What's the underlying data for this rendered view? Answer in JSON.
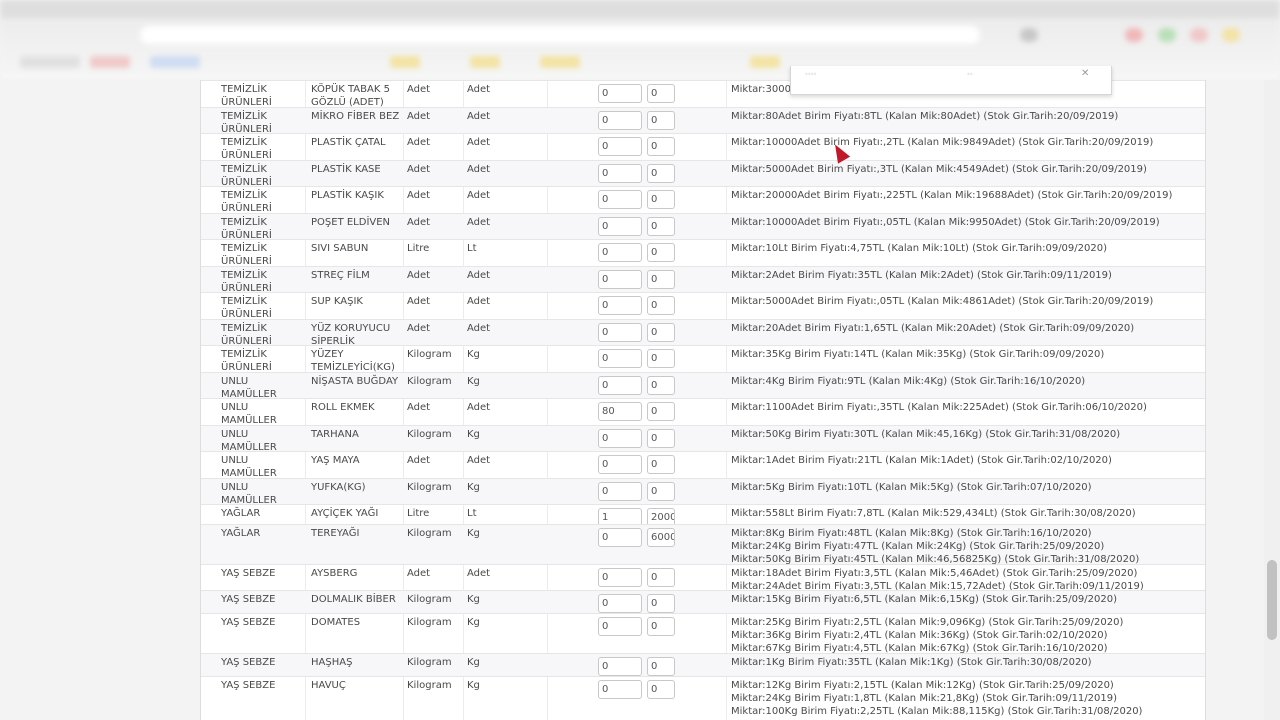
{
  "rows": [
    {
      "cat": "TEMİZLİK ÜRÜNLERİ",
      "name": "KÖPÜK TABAK 5 GÖZLÜ (ADET)",
      "unit1": "Adet",
      "unit2": "Adet",
      "v1": "0",
      "v2": "0",
      "info": [
        "Miktar:3000"
      ]
    },
    {
      "cat": "TEMİZLİK ÜRÜNLERİ",
      "name": "MİKRO FİBER BEZ",
      "unit1": "Adet",
      "unit2": "Adet",
      "v1": "0",
      "v2": "0",
      "info": [
        "Miktar:80Adet Birim Fiyatı:8TL (Kalan Mik:80Adet) (Stok Gir.Tarih:20/09/2019)"
      ]
    },
    {
      "cat": "TEMİZLİK ÜRÜNLERİ",
      "name": "PLASTİK ÇATAL",
      "unit1": "Adet",
      "unit2": "Adet",
      "v1": "0",
      "v2": "0",
      "info": [
        "Miktar:10000Adet Birim Fiyatı:,2TL (Kalan Mik:9849Adet) (Stok Gir.Tarih:20/09/2019)"
      ]
    },
    {
      "cat": "TEMİZLİK ÜRÜNLERİ",
      "name": "PLASTİK KASE",
      "unit1": "Adet",
      "unit2": "Adet",
      "v1": "0",
      "v2": "0",
      "info": [
        "Miktar:5000Adet Birim Fiyatı:,3TL (Kalan Mik:4549Adet) (Stok Gir.Tarih:20/09/2019)"
      ]
    },
    {
      "cat": "TEMİZLİK ÜRÜNLERİ",
      "name": "PLASTİK KAŞIK",
      "unit1": "Adet",
      "unit2": "Adet",
      "v1": "0",
      "v2": "0",
      "info": [
        "Miktar:20000Adet Birim Fiyatı:,225TL (Kalan Mik:19688Adet) (Stok Gir.Tarih:20/09/2019)"
      ]
    },
    {
      "cat": "TEMİZLİK ÜRÜNLERİ",
      "name": "POŞET ELDİVEN",
      "unit1": "Adet",
      "unit2": "Adet",
      "v1": "0",
      "v2": "0",
      "info": [
        "Miktar:10000Adet Birim Fiyatı:,05TL (Kalan Mik:9950Adet) (Stok Gir.Tarih:20/09/2019)"
      ]
    },
    {
      "cat": "TEMİZLİK ÜRÜNLERİ",
      "name": "SIVI SABUN",
      "unit1": "Litre",
      "unit2": "Lt",
      "v1": "0",
      "v2": "0",
      "info": [
        "Miktar:10Lt Birim Fiyatı:4,75TL (Kalan Mik:10Lt) (Stok Gir.Tarih:09/09/2020)"
      ]
    },
    {
      "cat": "TEMİZLİK ÜRÜNLERİ",
      "name": "STREÇ FİLM",
      "unit1": "Adet",
      "unit2": "Adet",
      "v1": "0",
      "v2": "0",
      "info": [
        "Miktar:2Adet Birim Fiyatı:35TL (Kalan Mik:2Adet) (Stok Gir.Tarih:09/11/2019)"
      ]
    },
    {
      "cat": "TEMİZLİK ÜRÜNLERİ",
      "name": "SUP KAŞIK",
      "unit1": "Adet",
      "unit2": "Adet",
      "v1": "0",
      "v2": "0",
      "info": [
        "Miktar:5000Adet Birim Fiyatı:,05TL (Kalan Mik:4861Adet) (Stok Gir.Tarih:20/09/2019)"
      ]
    },
    {
      "cat": "TEMİZLİK ÜRÜNLERİ",
      "name": "YÜZ KORUYUCU SİPERLİK",
      "unit1": "Adet",
      "unit2": "Adet",
      "v1": "0",
      "v2": "0",
      "info": [
        "Miktar:20Adet Birim Fiyatı:1,65TL (Kalan Mik:20Adet) (Stok Gir.Tarih:09/09/2020)"
      ]
    },
    {
      "cat": "TEMİZLİK ÜRÜNLERİ",
      "name": "YÜZEY TEMİZLEYİCİ(KG)",
      "unit1": "Kilogram",
      "unit2": "Kg",
      "v1": "0",
      "v2": "0",
      "info": [
        "Miktar:35Kg Birim Fiyatı:14TL (Kalan Mik:35Kg) (Stok Gir.Tarih:09/09/2020)"
      ]
    },
    {
      "cat": "UNLU MAMÜLLER",
      "name": "NİŞASTA BUĞDAY",
      "unit1": "Kilogram",
      "unit2": "Kg",
      "v1": "0",
      "v2": "0",
      "info": [
        "Miktar:4Kg Birim Fiyatı:9TL (Kalan Mik:4Kg) (Stok Gir.Tarih:16/10/2020)"
      ]
    },
    {
      "cat": "UNLU MAMÜLLER",
      "name": "ROLL EKMEK",
      "unit1": "Adet",
      "unit2": "Adet",
      "v1": "80",
      "v2": "0",
      "info": [
        "Miktar:1100Adet Birim Fiyatı:,35TL (Kalan Mik:225Adet) (Stok Gir.Tarih:06/10/2020)"
      ]
    },
    {
      "cat": "UNLU MAMÜLLER",
      "name": "TARHANA",
      "unit1": "Kilogram",
      "unit2": "Kg",
      "v1": "0",
      "v2": "0",
      "info": [
        "Miktar:50Kg Birim Fiyatı:30TL (Kalan Mik:45,16Kg) (Stok Gir.Tarih:31/08/2020)"
      ]
    },
    {
      "cat": "UNLU MAMÜLLER",
      "name": "YAŞ MAYA",
      "unit1": "Adet",
      "unit2": "Adet",
      "v1": "0",
      "v2": "0",
      "info": [
        "Miktar:1Adet Birim Fiyatı:21TL (Kalan Mik:1Adet) (Stok Gir.Tarih:02/10/2020)"
      ]
    },
    {
      "cat": "UNLU MAMÜLLER",
      "name": "YUFKA(KG)",
      "unit1": "Kilogram",
      "unit2": "Kg",
      "v1": "0",
      "v2": "0",
      "info": [
        "Miktar:5Kg Birim Fiyatı:10TL (Kalan Mik:5Kg) (Stok Gir.Tarih:07/10/2020)"
      ]
    },
    {
      "cat": "YAĞLAR",
      "name": "AYÇİÇEK YAĞI",
      "unit1": "Litre",
      "unit2": "Lt",
      "v1": "1",
      "v2": "2000",
      "info": [
        "Miktar:558Lt Birim Fiyatı:7,8TL (Kalan Mik:529,434Lt) (Stok Gir.Tarih:30/08/2020)"
      ]
    },
    {
      "cat": "YAĞLAR",
      "name": "TEREYAĞI",
      "unit1": "Kilogram",
      "unit2": "Kg",
      "v1": "0",
      "v2": "6000",
      "info": [
        "Miktar:8Kg Birim Fiyatı:48TL (Kalan Mik:8Kg) (Stok Gir.Tarih:16/10/2020)",
        "Miktar:24Kg Birim Fiyatı:47TL (Kalan Mik:24Kg) (Stok Gir.Tarih:25/09/2020)",
        "Miktar:50Kg Birim Fiyatı:45TL (Kalan Mik:46,56825Kg) (Stok Gir.Tarih:31/08/2020)"
      ]
    },
    {
      "cat": "YAŞ SEBZE",
      "name": "AYSBERG",
      "unit1": "Adet",
      "unit2": "Adet",
      "v1": "0",
      "v2": "0",
      "info": [
        "Miktar:18Adet Birim Fiyatı:3,5TL (Kalan Mik:5,46Adet) (Stok Gir.Tarih:25/09/2020)",
        "Miktar:24Adet Birim Fiyatı:3,5TL (Kalan Mik:15,72Adet) (Stok Gir.Tarih:09/11/2019)"
      ]
    },
    {
      "cat": "YAŞ SEBZE",
      "name": "DOLMALIK BİBER",
      "unit1": "Kilogram",
      "unit2": "Kg",
      "v1": "0",
      "v2": "0",
      "info": [
        "Miktar:15Kg Birim Fiyatı:6,5TL (Kalan Mik:6,15Kg) (Stok Gir.Tarih:25/09/2020)"
      ]
    },
    {
      "cat": "YAŞ SEBZE",
      "name": "DOMATES",
      "unit1": "Kilogram",
      "unit2": "Kg",
      "v1": "0",
      "v2": "0",
      "info": [
        "Miktar:25Kg Birim Fiyatı:2,5TL (Kalan Mik:9,096Kg) (Stok Gir.Tarih:25/09/2020)",
        "Miktar:36Kg Birim Fiyatı:2,4TL (Kalan Mik:36Kg) (Stok Gir.Tarih:02/10/2020)",
        "Miktar:67Kg Birim Fiyatı:4,5TL (Kalan Mik:67Kg) (Stok Gir.Tarih:16/10/2020)"
      ]
    },
    {
      "cat": "YAŞ SEBZE",
      "name": "HAŞHAŞ",
      "unit1": "Kilogram",
      "unit2": "Kg",
      "v1": "0",
      "v2": "0",
      "info": [
        "Miktar:1Kg Birim Fiyatı:35TL (Kalan Mik:1Kg) (Stok Gir.Tarih:30/08/2020)"
      ]
    },
    {
      "cat": "YAŞ SEBZE",
      "name": "HAVUÇ",
      "unit1": "Kilogram",
      "unit2": "Kg",
      "v1": "0",
      "v2": "0",
      "info": [
        "Miktar:12Kg Birim Fiyatı:2,15TL (Kalan Mik:12Kg) (Stok Gir.Tarih:25/09/2020)",
        "Miktar:24Kg Birim Fiyatı:1,8TL (Kalan Mik:21,8Kg) (Stok Gir.Tarih:09/11/2019)",
        "Miktar:100Kg Birim Fiyatı:2,25TL (Kalan Mik:88,115Kg) (Stok Gir.Tarih:31/08/2020)"
      ]
    }
  ]
}
